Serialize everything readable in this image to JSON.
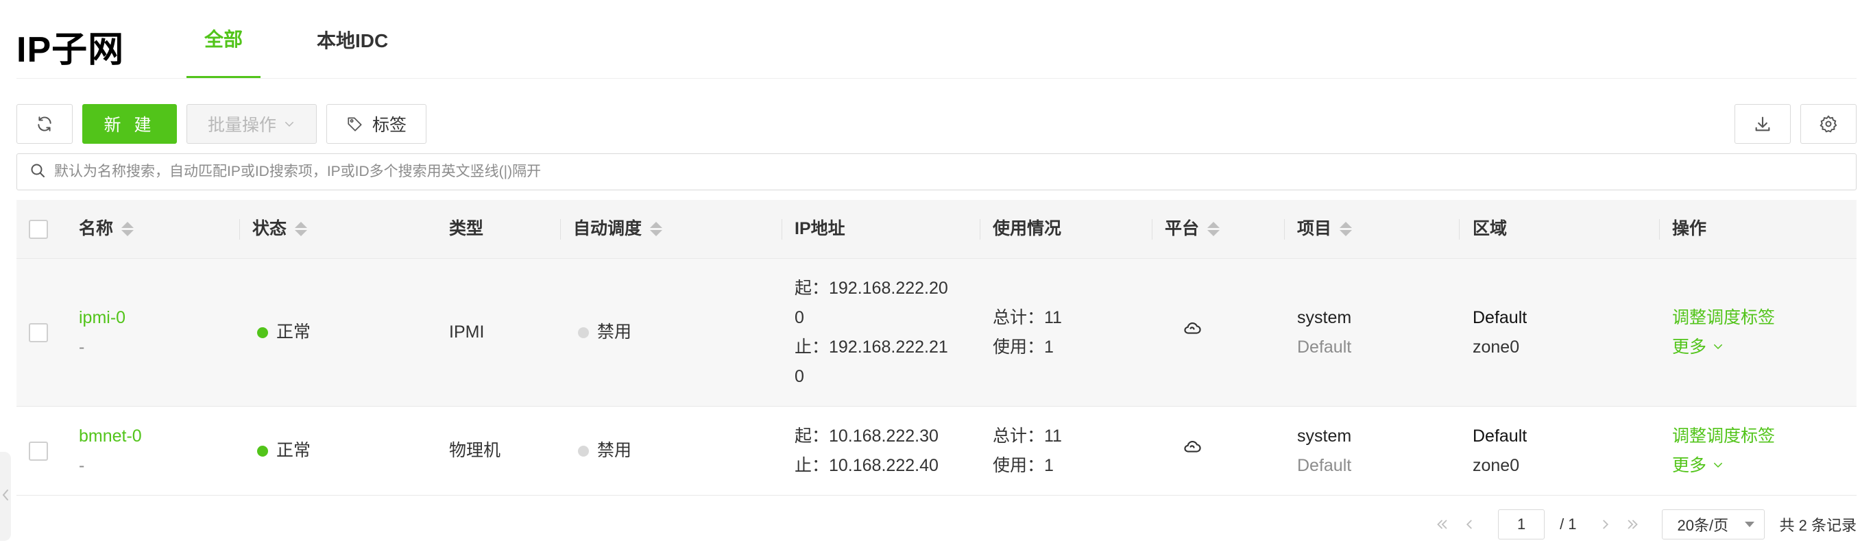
{
  "header": {
    "title": "IP子网",
    "tabs": [
      {
        "label": "全部",
        "active": true
      },
      {
        "label": "本地IDC",
        "active": false
      }
    ]
  },
  "toolbar": {
    "new_label": "新 建",
    "batch_label": "批量操作",
    "tag_label": "标签",
    "icons": [
      "refresh-icon",
      "tag-icon",
      "download-icon",
      "gear-icon"
    ]
  },
  "search": {
    "placeholder": "默认为名称搜索，自动匹配IP或ID搜索项，IP或ID多个搜索用英文竖线(|)隔开"
  },
  "table": {
    "columns": [
      "名称",
      "状态",
      "类型",
      "自动调度",
      "IP地址",
      "使用情况",
      "平台",
      "项目",
      "区域",
      "操作"
    ],
    "rows": [
      {
        "name": "ipmi-0",
        "desc": "-",
        "status": "正常",
        "type": "IPMI",
        "auto_schedule": "禁用",
        "ip_lines": [
          "起：192.168.222.20",
          "0",
          "止：192.168.222.21",
          "0"
        ],
        "usage_total": "总计：11",
        "usage_used": "使用：1",
        "platform_icon": "cloud-icon",
        "project": "system",
        "project_domain": "Default",
        "region": "Default",
        "zone": "zone0",
        "action": "调整调度标签",
        "more": "更多"
      },
      {
        "name": "bmnet-0",
        "desc": "-",
        "status": "正常",
        "type": "物理机",
        "auto_schedule": "禁用",
        "ip_lines": [
          "起：10.168.222.30",
          "止：10.168.222.40"
        ],
        "usage_total": "总计：11",
        "usage_used": "使用：1",
        "platform_icon": "cloud-icon",
        "project": "system",
        "project_domain": "Default",
        "region": "Default",
        "zone": "zone0",
        "action": "调整调度标签",
        "more": "更多"
      }
    ]
  },
  "pagination": {
    "current_page": "1",
    "total_pages": "/ 1",
    "page_size": "20条/页",
    "total": "共 2 条记录"
  },
  "colors": {
    "accent": "#52c41a",
    "disabled_dot": "#d9d9d9",
    "header_bg": "#f5f5f5"
  }
}
